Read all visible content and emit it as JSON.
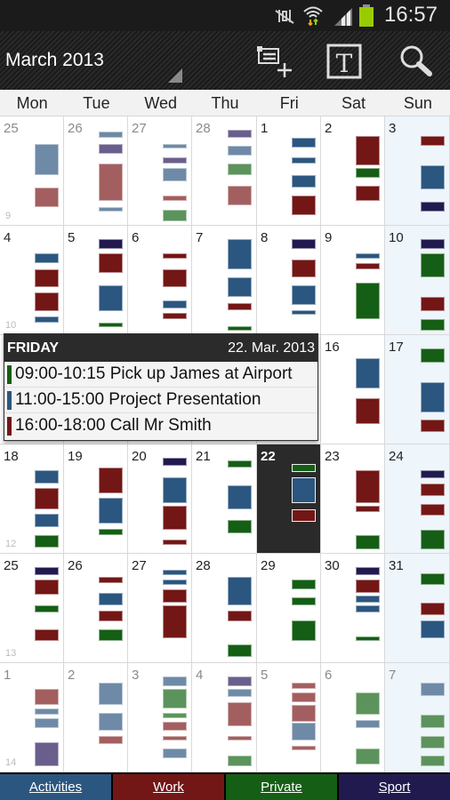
{
  "status_bar": {
    "time": "16:57",
    "icons": [
      "mute-vibrate-icon",
      "wifi-icon",
      "signal-icon",
      "battery-icon"
    ]
  },
  "app_bar": {
    "title": "March 2013",
    "actions": [
      "new-event-icon",
      "text-view-icon",
      "search-icon"
    ]
  },
  "weekdays": [
    "Mon",
    "Tue",
    "Wed",
    "Thu",
    "Fri",
    "Sat",
    "Sun"
  ],
  "colors": {
    "A": "#2b567f",
    "W": "#731616",
    "P": "#155e15",
    "S": "#211a4f",
    "A_faded": "#6f8aa6",
    "W_faded": "#a35f5f",
    "P_faded": "#5c935c",
    "S_faded": "#6a5f8c"
  },
  "categories": [
    {
      "key": "A",
      "label": "Activities"
    },
    {
      "key": "W",
      "label": "Work"
    },
    {
      "key": "P",
      "label": "Private"
    },
    {
      "key": "S",
      "label": "Sport"
    }
  ],
  "today": "22",
  "weeks": [
    {
      "week": "9",
      "days": [
        {
          "day": "25",
          "faded": true,
          "events": [
            [
              10.25,
              15,
              "A"
            ],
            [
              17,
              20,
              "W"
            ]
          ]
        },
        {
          "day": "26",
          "faded": true,
          "events": [
            [
              8.25,
              9.25,
              "A"
            ],
            [
              10.25,
              11.75,
              "S"
            ],
            [
              13.25,
              19,
              "W"
            ],
            [
              20,
              20.75,
              "A"
            ]
          ]
        },
        {
          "day": "27",
          "faded": true,
          "events": [
            [
              10.25,
              10.75,
              "A"
            ],
            [
              12.25,
              13.25,
              "S"
            ],
            [
              14,
              16,
              "A"
            ],
            [
              18.25,
              19,
              "W"
            ],
            [
              20.5,
              22.25,
              "P"
            ]
          ]
        },
        {
          "day": "28",
          "faded": true,
          "events": [
            [
              8,
              9.25,
              "S"
            ],
            [
              10.5,
              12,
              "A"
            ],
            [
              13.25,
              15,
              "P"
            ],
            [
              16.75,
              19.75,
              "W"
            ]
          ]
        },
        {
          "day": "1",
          "events": [
            [
              9.25,
              10.75,
              "A"
            ],
            [
              12.25,
              13.25,
              "A"
            ],
            [
              15,
              17,
              "A"
            ],
            [
              18.25,
              21.25,
              "W"
            ]
          ]
        },
        {
          "day": "2",
          "events": [
            [
              9,
              13.5,
              "W"
            ],
            [
              14,
              15.5,
              "P"
            ],
            [
              16.75,
              19,
              "W"
            ]
          ]
        },
        {
          "day": "3",
          "events": [
            [
              9,
              10.5,
              "W"
            ],
            [
              13.5,
              17.25,
              "A"
            ],
            [
              19.25,
              20.75,
              "S"
            ]
          ]
        }
      ]
    },
    {
      "week": "10",
      "days": [
        {
          "day": "4",
          "events": [
            [
              10.25,
              11.75,
              "A"
            ],
            [
              12.75,
              15.5,
              "W"
            ],
            [
              16.25,
              19.25,
              "W"
            ],
            [
              20,
              21,
              "A"
            ]
          ]
        },
        {
          "day": "5",
          "events": [
            [
              8,
              9.5,
              "S"
            ],
            [
              10.25,
              13.25,
              "W"
            ],
            [
              15.25,
              19.25,
              "A"
            ],
            [
              21,
              21.75,
              "P"
            ]
          ]
        },
        {
          "day": "6",
          "events": [
            [
              10.25,
              11,
              "W"
            ],
            [
              12.75,
              15.5,
              "W"
            ],
            [
              17.5,
              18.75,
              "A"
            ],
            [
              19.5,
              20.5,
              "W"
            ]
          ]
        },
        {
          "day": "7",
          "events": [
            [
              8,
              12.75,
              "A"
            ],
            [
              14,
              17,
              "A"
            ],
            [
              18,
              19,
              "W"
            ],
            [
              21.5,
              22.25,
              "P"
            ]
          ]
        },
        {
          "day": "8",
          "events": [
            [
              8,
              9.5,
              "S"
            ],
            [
              11.25,
              14,
              "W"
            ],
            [
              15.25,
              18.25,
              "A"
            ],
            [
              19,
              19.75,
              "A"
            ]
          ]
        },
        {
          "day": "9",
          "events": [
            [
              10.25,
              11,
              "A"
            ],
            [
              11.75,
              12.75,
              "W"
            ],
            [
              14.75,
              20.5,
              "P"
            ]
          ]
        },
        {
          "day": "10",
          "events": [
            [
              8,
              9.5,
              "S"
            ],
            [
              10.25,
              14,
              "P"
            ],
            [
              17,
              19.25,
              "W"
            ],
            [
              20.5,
              22.25,
              "P"
            ]
          ]
        }
      ]
    },
    {
      "week": "",
      "days": [
        {
          "day": "",
          "events": []
        },
        {
          "day": "",
          "events": []
        },
        {
          "day": "",
          "events": []
        },
        {
          "day": "",
          "events": []
        },
        {
          "day": "",
          "events": []
        },
        {
          "day": "16",
          "events": [
            [
              9.5,
              14.25,
              "A"
            ],
            [
              15.75,
              19.75,
              "W"
            ]
          ]
        },
        {
          "day": "17",
          "events": [
            [
              8,
              10.25,
              "P"
            ],
            [
              13.25,
              18,
              "A"
            ],
            [
              19,
              21,
              "W"
            ]
          ]
        }
      ]
    },
    {
      "week": "12",
      "days": [
        {
          "day": "18",
          "events": [
            [
              10,
              12,
              "A"
            ],
            [
              12.75,
              16,
              "W"
            ],
            [
              16.75,
              18.75,
              "A"
            ],
            [
              20,
              22,
              "P"
            ]
          ]
        },
        {
          "day": "19",
          "events": [
            [
              9.5,
              13.5,
              "W"
            ],
            [
              14.25,
              18.25,
              "A"
            ],
            [
              19,
              20,
              "P"
            ]
          ]
        },
        {
          "day": "20",
          "events": [
            [
              8,
              9.25,
              "S"
            ],
            [
              11,
              15,
              "A"
            ],
            [
              15.5,
              19.25,
              "W"
            ],
            [
              20.75,
              21.5,
              "W"
            ]
          ]
        },
        {
          "day": "21",
          "events": [
            [
              8.5,
              9.5,
              "P"
            ],
            [
              12.25,
              16,
              "A"
            ],
            [
              17.75,
              19.75,
              "P"
            ]
          ]
        },
        {
          "day": "22",
          "events": [
            [
              9,
              10.25,
              "P"
            ],
            [
              11,
              15,
              "A"
            ],
            [
              16,
              18,
              "W"
            ]
          ]
        },
        {
          "day": "23",
          "events": [
            [
              10,
              15,
              "W"
            ],
            [
              15.5,
              16.5,
              "W"
            ],
            [
              20,
              22.25,
              "P"
            ]
          ]
        },
        {
          "day": "24",
          "events": [
            [
              10,
              11.25,
              "S"
            ],
            [
              12,
              14,
              "W"
            ],
            [
              15.25,
              17,
              "W"
            ],
            [
              19.25,
              22.25,
              "P"
            ]
          ]
        }
      ]
    },
    {
      "week": "13",
      "days": [
        {
          "day": "25",
          "events": [
            [
              8,
              9.25,
              "S"
            ],
            [
              10,
              12.25,
              "W"
            ],
            [
              14,
              15,
              "P"
            ],
            [
              17.75,
              19.5,
              "W"
            ]
          ]
        },
        {
          "day": "26",
          "events": [
            [
              9.5,
              10.5,
              "W"
            ],
            [
              12,
              14,
              "A"
            ],
            [
              14.75,
              16.5,
              "W"
            ],
            [
              17.75,
              19.5,
              "P"
            ]
          ]
        },
        {
          "day": "27",
          "events": [
            [
              8.5,
              9.25,
              "A"
            ],
            [
              10,
              10.75,
              "A"
            ],
            [
              11.5,
              13.5,
              "W"
            ],
            [
              14,
              19,
              "W"
            ]
          ]
        },
        {
          "day": "28",
          "events": [
            [
              9.5,
              14,
              "A"
            ],
            [
              14.75,
              16.5,
              "W"
            ],
            [
              20,
              22,
              "P"
            ]
          ]
        },
        {
          "day": "29",
          "events": [
            [
              10,
              11.5,
              "P"
            ],
            [
              12.75,
              14,
              "P"
            ],
            [
              16.25,
              19.5,
              "P"
            ]
          ]
        },
        {
          "day": "30",
          "events": [
            [
              8,
              9.25,
              "S"
            ],
            [
              10,
              12,
              "W"
            ],
            [
              12.5,
              13.5,
              "A"
            ],
            [
              14,
              15,
              "A"
            ],
            [
              18.75,
              19.5,
              "P"
            ]
          ]
        },
        {
          "day": "31",
          "events": [
            [
              9,
              10.75,
              "P"
            ],
            [
              13.5,
              15.5,
              "W"
            ],
            [
              16.25,
              19,
              "A"
            ]
          ]
        }
      ]
    },
    {
      "week": "14",
      "days": [
        {
          "day": "1",
          "faded": true,
          "events": [
            [
              10,
              12.5,
              "W"
            ],
            [
              13,
              14,
              "A"
            ],
            [
              14.5,
              16,
              "A"
            ],
            [
              18.25,
              22,
              "S"
            ]
          ]
        },
        {
          "day": "2",
          "faded": true,
          "events": [
            [
              9,
              12.5,
              "A"
            ],
            [
              13.75,
              16.5,
              "A"
            ],
            [
              17.25,
              18.5,
              "W"
            ]
          ]
        },
        {
          "day": "3",
          "faded": true,
          "events": [
            [
              8,
              9.5,
              "A"
            ],
            [
              10,
              13,
              "P"
            ],
            [
              13.75,
              14.5,
              "P"
            ],
            [
              15,
              16.5,
              "W"
            ],
            [
              17.25,
              18,
              "W"
            ],
            [
              19.25,
              20.75,
              "A"
            ]
          ]
        },
        {
          "day": "4",
          "faded": true,
          "events": [
            [
              8,
              9.5,
              "S"
            ],
            [
              10,
              11.25,
              "A"
            ],
            [
              12,
              15.75,
              "W"
            ],
            [
              17.25,
              18,
              "W"
            ],
            [
              20.25,
              22,
              "P"
            ]
          ]
        },
        {
          "day": "5",
          "faded": true,
          "events": [
            [
              9,
              10,
              "W"
            ],
            [
              10.5,
              12,
              "W"
            ],
            [
              12.5,
              15,
              "W"
            ],
            [
              15.25,
              18,
              "A"
            ],
            [
              18.75,
              19.5,
              "W"
            ]
          ]
        },
        {
          "day": "6",
          "faded": true,
          "events": [
            [
              10.5,
              14,
              "P"
            ],
            [
              14.75,
              16,
              "A"
            ],
            [
              19.25,
              21.75,
              "P"
            ]
          ]
        },
        {
          "day": "7",
          "faded": true,
          "events": [
            [
              9,
              11,
              "A"
            ],
            [
              14,
              16,
              "P"
            ],
            [
              17.25,
              19.25,
              "P"
            ],
            [
              20.25,
              22,
              "P"
            ]
          ]
        }
      ]
    }
  ],
  "popup": {
    "weekday": "FRIDAY",
    "date": "22. Mar. 2013",
    "items": [
      {
        "text": "09:00-10:15 Pick up James at Airport",
        "cat": "P"
      },
      {
        "text": "11:00-15:00 Project Presentation",
        "cat": "A"
      },
      {
        "text": "16:00-18:00 Call Mr Smith",
        "cat": "W"
      }
    ]
  }
}
